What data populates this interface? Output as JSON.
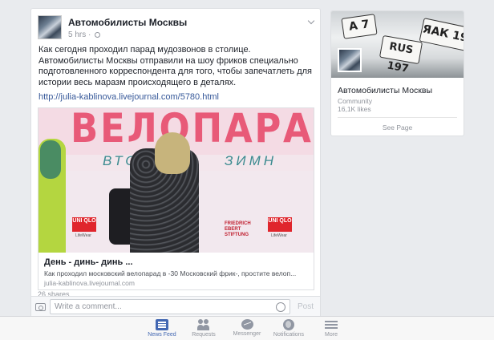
{
  "post": {
    "author": "Автомобилисты Москвы",
    "time": "5 hrs",
    "text": "Как сегодня проходил парад мудозвонов в столице. Автомобилисты Москвы  отправили на шоу фриков специально подготовленного корреспондента для того, чтобы запечатлеть для истории весь маразм происходящего в деталях.",
    "link": "http://julia-kablinova.livejournal.com/5780.html",
    "attachment": {
      "banner_text": "ВЕЛОПАРА",
      "banner_sub_left": "ВТОД",
      "banner_sub_right": "ЗИМН",
      "brand_logo": "UNI QLO",
      "brand_wear": "LifeWear",
      "sponsor": "FRIEDRICH EBERT STIFTUNG",
      "title": "День - динь- динь ...",
      "description": "Как проходил московский велопарад в -30 Московский фрик-, простите велоп...",
      "domain": "julia-kablinova.livejournal.com"
    },
    "shares": "26 shares"
  },
  "comment": {
    "placeholder": "Write a comment...",
    "post_label": "Post"
  },
  "page_card": {
    "name": "Автомобилисты Москвы",
    "category": "Community",
    "likes": "16,1K likes",
    "see_page": "See Page",
    "plates": [
      "A 7",
      "RUS 197",
      "ЯАК 19"
    ]
  },
  "tabs": [
    {
      "label": "News Feed",
      "icon": "news-feed-icon",
      "active": true
    },
    {
      "label": "Requests",
      "icon": "friend-requests-icon",
      "active": false
    },
    {
      "label": "Messenger",
      "icon": "messenger-icon",
      "active": false
    },
    {
      "label": "Notifications",
      "icon": "globe-notifications-icon",
      "active": false
    },
    {
      "label": "More",
      "icon": "menu-icon",
      "active": false
    }
  ],
  "colors": {
    "accent": "#4267b2",
    "link": "#365899",
    "background": "#e9ebee",
    "banner_pink": "#e85a78"
  }
}
